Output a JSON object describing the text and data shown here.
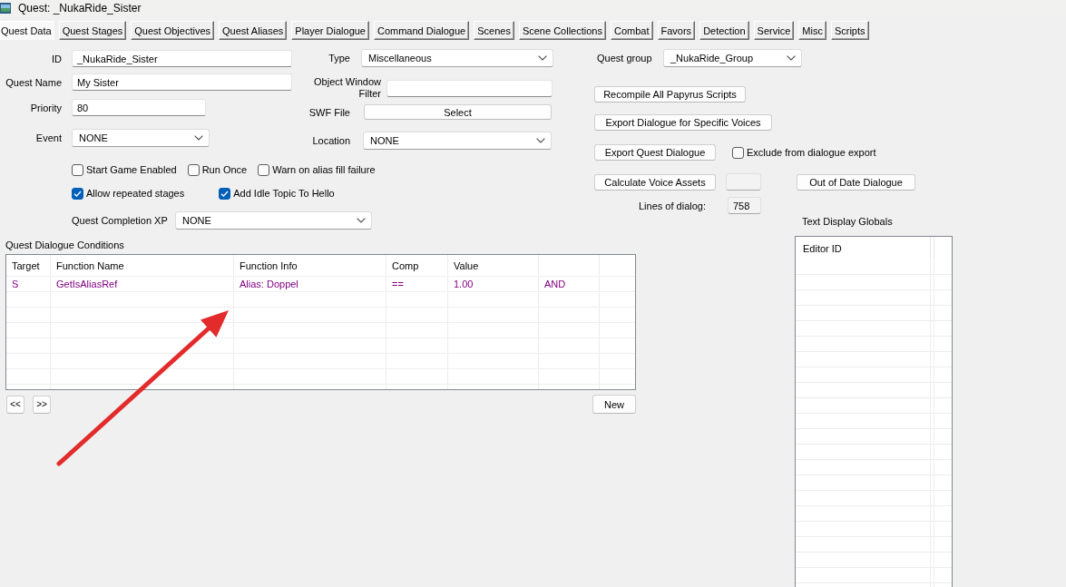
{
  "window": {
    "title": "Quest: _NukaRide_Sister"
  },
  "tabs": [
    {
      "label": "Quest Data",
      "selected": true
    },
    {
      "label": "Quest Stages",
      "selected": false
    },
    {
      "label": "Quest Objectives",
      "selected": false
    },
    {
      "label": "Quest Aliases",
      "selected": false
    },
    {
      "label": "Player Dialogue",
      "selected": false
    },
    {
      "label": "Command Dialogue",
      "selected": false
    },
    {
      "label": "Scenes",
      "selected": false
    },
    {
      "label": "Scene Collections",
      "selected": false
    },
    {
      "label": "Combat",
      "selected": false
    },
    {
      "label": "Favors",
      "selected": false
    },
    {
      "label": "Detection",
      "selected": false
    },
    {
      "label": "Service",
      "selected": false
    },
    {
      "label": "Misc",
      "selected": false
    },
    {
      "label": "Scripts",
      "selected": false
    }
  ],
  "form": {
    "id": {
      "label": "ID",
      "value": "_NukaRide_Sister"
    },
    "quest_name": {
      "label": "Quest Name",
      "value": "My Sister"
    },
    "priority": {
      "label": "Priority",
      "value": "80"
    },
    "event": {
      "label": "Event",
      "value": "NONE"
    },
    "type": {
      "label": "Type",
      "value": "Miscellaneous"
    },
    "object_window_filter": {
      "label": "Object Window Filter"
    },
    "swf_file": {
      "label": "SWF File",
      "button": "Select"
    },
    "location": {
      "label": "Location",
      "value": "NONE"
    },
    "option_rows": [
      [
        {
          "label": "Start Game Enabled",
          "checked": false
        },
        {
          "label": "Run Once",
          "checked": false
        },
        {
          "label": "Warn on alias fill failure",
          "checked": false
        }
      ],
      [
        {
          "label": "Allow repeated stages",
          "checked": true
        },
        {
          "label": "Add Idle Topic To Hello",
          "checked": true
        }
      ]
    ],
    "quest_completion_xp": {
      "label": "Quest Completion XP",
      "value": "NONE"
    }
  },
  "actions": {
    "quest_group": {
      "label": "Quest group",
      "value": "_NukaRide_Group"
    },
    "recompile": "Recompile All Papyrus Scripts",
    "export_voices": "Export Dialogue for Specific Voices",
    "export_quest_dialogue": "Export Quest Dialogue",
    "exclude_from_export": {
      "label": "Exclude from dialogue export",
      "checked": false
    },
    "calculate_voice_assets": "Calculate Voice Assets",
    "voice_assets_field": {
      "disabled": true
    },
    "out_of_date_dialogue": "Out of Date Dialogue",
    "lines_of_dialog": {
      "label": "Lines of dialog:",
      "value": "758",
      "disabled": true
    }
  },
  "conditions": {
    "label": "Quest Dialogue Conditions",
    "columns": [
      "Target",
      "Function Name",
      "Function Info",
      "Comp",
      "Value"
    ],
    "rows": [
      [
        "S",
        "GetIsAliasRef",
        "Alias: Doppel",
        "==",
        "1.00",
        "AND"
      ]
    ],
    "page_buttons": [
      "<<",
      ">>"
    ],
    "new_button": "New"
  },
  "text_display_globals": {
    "label": "Text Display Globals",
    "columns": [
      "Editor ID"
    ]
  },
  "annotation": {
    "kind": "arrow"
  }
}
